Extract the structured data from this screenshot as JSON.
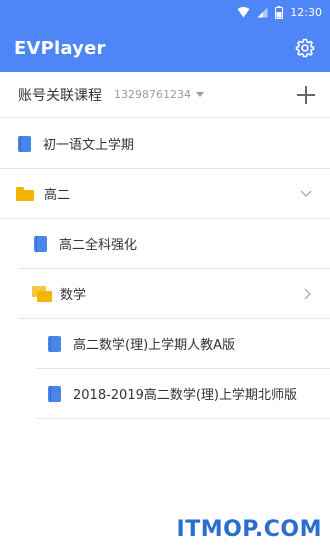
{
  "status_bar": {
    "time": "12:30"
  },
  "app": {
    "title": "EVPlayer"
  },
  "account": {
    "label": "账号关联课程",
    "number": "13298761234"
  },
  "tree": {
    "items": [
      {
        "label": "初一语文上学期"
      },
      {
        "label": "高二"
      },
      {
        "label": "高二全科强化"
      },
      {
        "label": "数学"
      },
      {
        "label": "高二数学(理)上学期人教A版"
      },
      {
        "label": "2018-2019高二数学(理)上学期北师版"
      }
    ]
  },
  "watermark": {
    "text": "ITMOP.COM"
  },
  "colors": {
    "app_bar": "#4f86f7",
    "book_icon": "#4a86e8",
    "folder_icon": "#f5b400"
  }
}
